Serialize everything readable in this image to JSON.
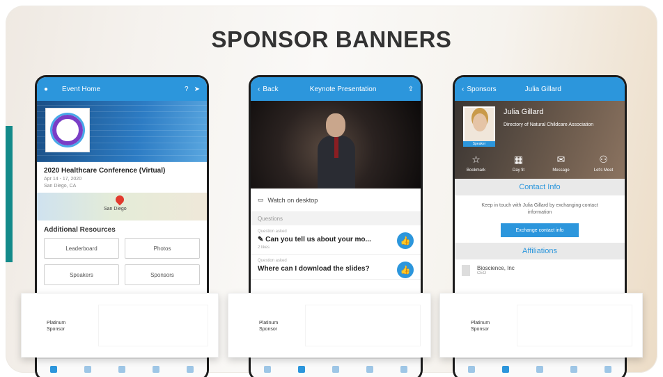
{
  "title": "SPONSOR BANNERS",
  "phone1": {
    "appbar_title": "Event Home",
    "event_title": "2020 Healthcare Conference (Virtual)",
    "event_dates": "Apr 14 - 17, 2020",
    "event_location": "San Diego, CA",
    "map_label": "San Diego",
    "resources_title": "Additional Resources",
    "resources": [
      "Leaderboard",
      "Photos",
      "Speakers",
      "Sponsors"
    ]
  },
  "phone2": {
    "back_label": "Back",
    "appbar_title": "Keynote Presentation",
    "watch_label": "Watch on desktop",
    "section_label": "Questions",
    "questions": [
      {
        "meta": "Question asked",
        "text": "Can you tell us about your mo...",
        "footer": "2 likes"
      },
      {
        "meta": "Question asked",
        "text": "Where can I download the slides?",
        "footer": ""
      }
    ]
  },
  "phone3": {
    "back_label": "Sponsors",
    "appbar_title": "Julia Gillard",
    "name": "Julia Gillard",
    "role": "Directory of Natural Childcare Association",
    "photo_tag": "Speaker",
    "actions": [
      "Bookmark",
      "Day fit",
      "Message",
      "Let's Meet"
    ],
    "contact_title": "Contact Info",
    "contact_text": "Keep in touch with Julia Gillard by exchanging contact information",
    "exchange_button": "Exchange contact info",
    "affiliations_title": "Affiliations",
    "affiliation_name": "Bioscience, Inc",
    "affiliation_sub": "CEO"
  },
  "sponsors": [
    {
      "label_line1": "Platinum",
      "label_line2": "Sponsor"
    },
    {
      "label_line1": "Platinum",
      "label_line2": "Sponsor"
    },
    {
      "label_line1": "Platinum",
      "label_line2": "Sponsor"
    }
  ],
  "icons": [
    "back-chevron-icon",
    "share-icon",
    "pin-icon",
    "thumbs-up-icon",
    "monitor-icon",
    "star-icon",
    "calendar-icon",
    "mail-icon",
    "meet-icon"
  ],
  "colors": {
    "accent": "#2c96dc",
    "teal": "#138a8a"
  }
}
